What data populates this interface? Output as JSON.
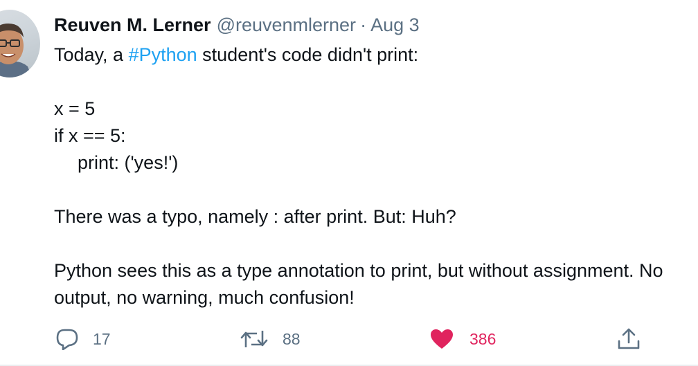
{
  "tweet": {
    "author_name": "Reuven M. Lerner",
    "handle": "@reuvenmlerner",
    "separator": "·",
    "date": "Aug 3",
    "line1_prefix": "Today, a ",
    "hashtag": "#Python",
    "line1_suffix": " student's code didn't print:",
    "code_line1": "x = 5",
    "code_line2": "if x == 5:",
    "code_line3": "print: ('yes!')",
    "line_typo": "There was a typo, namely : after print. But: Huh?",
    "line_explain1": "Python sees this as a type annotation to print, but without assignment. No",
    "line_explain2": "output, no warning, much confusion!"
  },
  "actions": {
    "reply_count": "17",
    "retweet_count": "88",
    "like_count": "386"
  },
  "icons": {
    "reply": "reply-icon",
    "retweet": "retweet-icon",
    "like": "heart-icon",
    "share": "share-icon"
  },
  "colors": {
    "link": "#1da1f2",
    "muted": "#5b7083",
    "like": "#e0245e",
    "text": "#0f1419"
  }
}
